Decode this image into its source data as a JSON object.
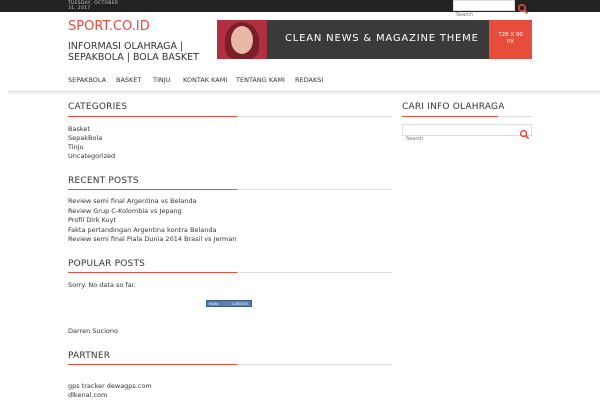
{
  "topbar": {
    "date": "TUESDAY, OCTOBER 31, 2017",
    "search_placeholder": "Search"
  },
  "site": {
    "title": "SPORT.CO.ID",
    "tagline": "INFORMASI OLAHRAGA | SEPAKBOLA | BOLA BASKET"
  },
  "banner": {
    "headline": "CLEAN NEWS & MAGAZINE THEME",
    "size_line1": "728 X 90",
    "size_line2": "PX"
  },
  "nav": {
    "items": [
      "SEPAKBOLA",
      "BASKET",
      "TINJU",
      "KONTAK KAMI",
      "TENTANG KAMI",
      "REDAKSI"
    ]
  },
  "categories": {
    "heading": "CATEGORIES",
    "items": [
      "Basket",
      "SepakBola",
      "Tinju",
      "Uncategorized"
    ]
  },
  "recent_posts": {
    "heading": "RECENT POSTS",
    "items": [
      "Review semi final Argentina vs Belanda",
      "Review Grup C-Kolombia vs Jepang",
      "Profil Dirk Kuyt",
      "Fakta pertandingan Argentina kontra Belanda",
      "Review semi final Piala Dunia 2014 Brasil vs Jerman"
    ]
  },
  "popular_posts": {
    "heading": "POPULAR POSTS",
    "empty_text": "Sorry. No data so far.",
    "badge_left": "Visits",
    "badge_right": "1,084,671",
    "author": "Darren Suciono"
  },
  "partner": {
    "heading": "PARTNER",
    "items": [
      "gps tracker dewagps.com",
      "dlkenal.com"
    ]
  },
  "sidebar": {
    "heading": "CARI INFO OLAHRAGA",
    "search_placeholder": "Search"
  },
  "colors": {
    "accent": "#e74c3c",
    "topbar": "#222222",
    "banner_bg": "#3a3a3a"
  }
}
